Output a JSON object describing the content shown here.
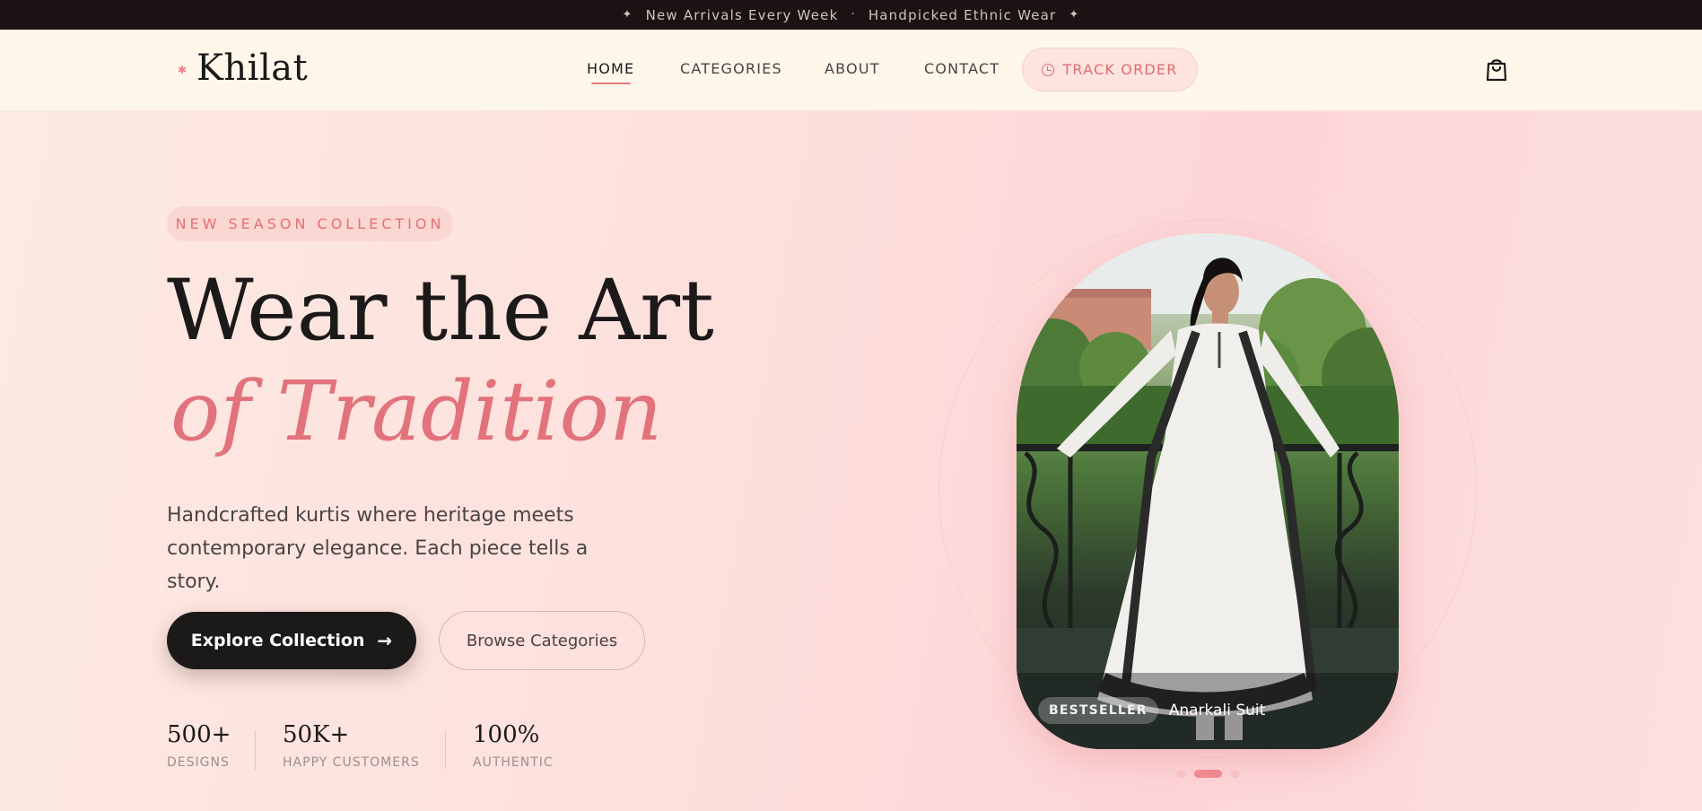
{
  "announcement": {
    "left_star": "✦",
    "text_1": "New Arrivals Every Week",
    "separator": "·",
    "text_2": "Handpicked Ethnic Wear",
    "right_star": "✦"
  },
  "header": {
    "logo_text": "Khilat",
    "nav": [
      {
        "label": "HOME",
        "active": true
      },
      {
        "label": "CATEGORIES"
      },
      {
        "label": "ABOUT"
      },
      {
        "label": "CONTACT"
      }
    ],
    "track_order_label": "TRACK ORDER",
    "cart_icon": "shopping-bag-icon"
  },
  "hero": {
    "badge": "NEW SEASON COLLECTION",
    "headline_line1": "Wear the Art",
    "headline_line2": "of Tradition",
    "lede": "Handcrafted kurtis where heritage meets contemporary elegance. Each piece tells a story.",
    "primary_cta": "Explore Collection",
    "primary_cta_icon": "arrow-right-icon",
    "secondary_cta": "Browse Categories",
    "stats": [
      {
        "value": "500+",
        "label": "DESIGNS"
      },
      {
        "value": "50K+",
        "label": "HAPPY CUSTOMERS"
      },
      {
        "value": "100%",
        "label": "AUTHENTIC"
      }
    ],
    "product_tag": "BESTSELLER",
    "product_name": "Anarkali Suit",
    "carousel": {
      "slides": 3,
      "active_index": 1
    }
  },
  "colors": {
    "accent": "#e2727b",
    "dark": "#1c1919",
    "topbar": "#1b1313",
    "header_bg": "#fff6ea"
  }
}
